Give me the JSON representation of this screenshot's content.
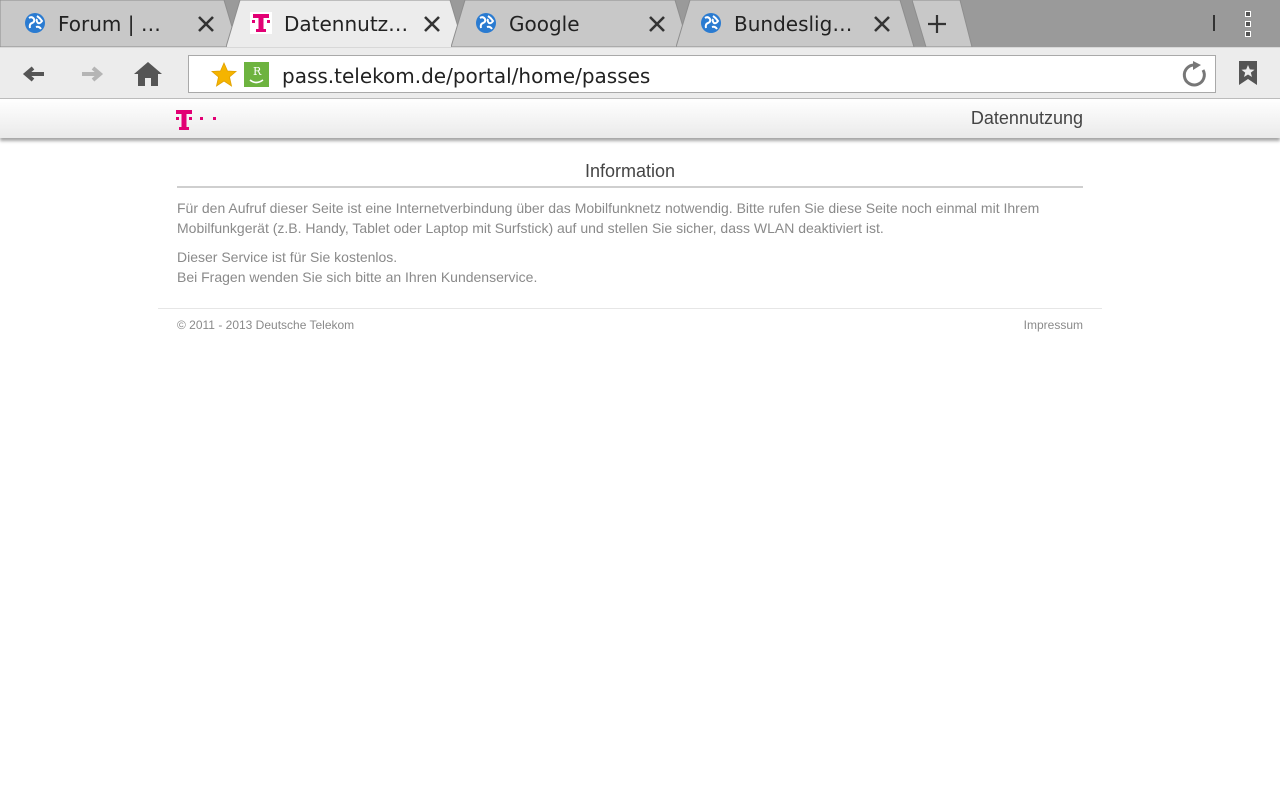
{
  "browser": {
    "tabs": [
      {
        "title": "Forum | MDR",
        "icon": "globe-icon",
        "active": false
      },
      {
        "title": "Datennutzung",
        "icon": "telekom-icon",
        "active": true
      },
      {
        "title": "Google",
        "icon": "globe-icon",
        "active": false
      },
      {
        "title": "Bundesligen",
        "icon": "globe-icon",
        "active": false
      }
    ],
    "address": "pass.telekom.de/portal/home/passes"
  },
  "site": {
    "header_title": "Datennutzung",
    "info_title": "Information",
    "para1": "Für den Aufruf dieser Seite ist eine Internetverbindung über das Mobilfunknetz notwendig. Bitte rufen Sie diese Seite noch einmal mit Ihrem Mobilfunkgerät (z.B. Handy, Tablet oder Laptop mit Surfstick) auf und stellen Sie sicher, dass WLAN deaktiviert ist.",
    "para2_line1": "Dieser Service ist für Sie kostenlos.",
    "para2_line2": "Bei Fragen wenden Sie sich bitte an Ihren Kundenservice.",
    "copyright": "© 2011 - 2013 Deutsche Telekom",
    "impressum": "Impressum"
  },
  "colors": {
    "telekom_magenta": "#e20074",
    "favicon_blue": "#2a7bd1",
    "star": "#f5b400",
    "ext_green": "#6db33f"
  }
}
